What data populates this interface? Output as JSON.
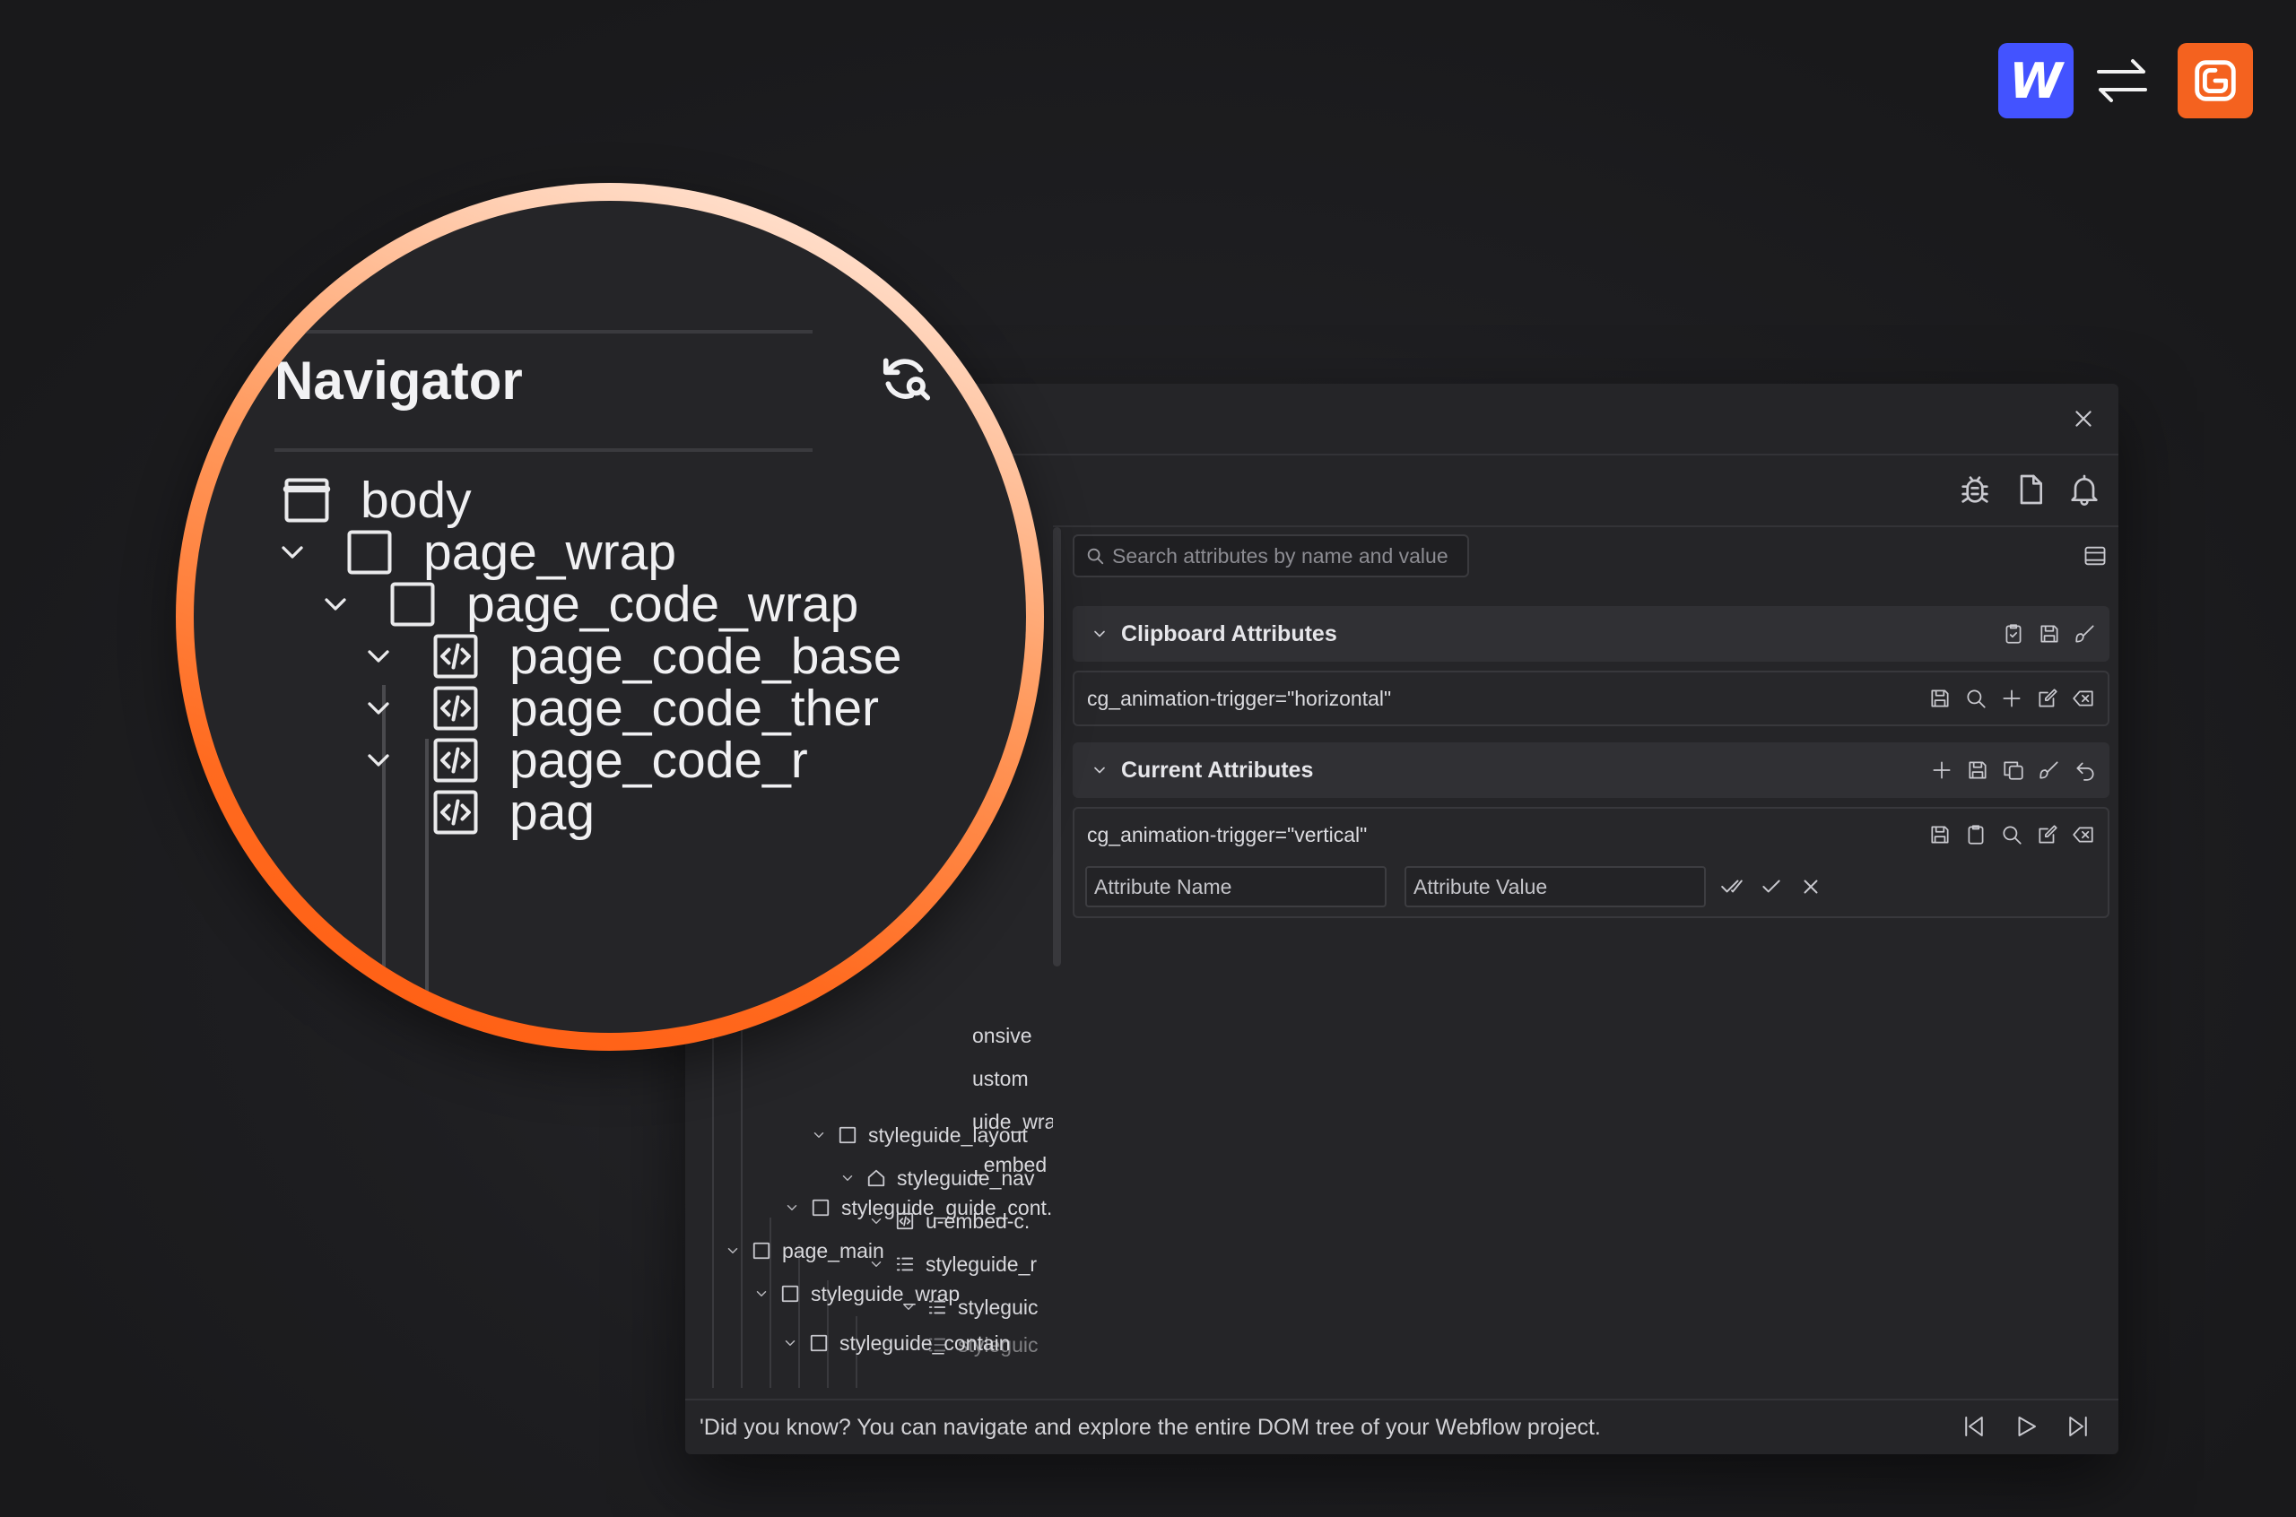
{
  "brand": {
    "webflow_logo_letter": "W",
    "webflow_color": "#4353ff",
    "app_color": "#f4621f",
    "swap_icon": "swap-arrows-icon"
  },
  "magnifier": {
    "title": "Navigator",
    "refresh_icon": "refresh-search-icon",
    "items": [
      {
        "label": "body",
        "icon": "body-icon"
      },
      {
        "label": "page_wrap",
        "icon": "box-icon"
      },
      {
        "label": "page_code_wrap",
        "icon": "box-icon"
      },
      {
        "label": "page_code_base",
        "icon": "code-icon"
      },
      {
        "label": "page_code_ther",
        "icon": "code-icon"
      },
      {
        "label": "page_code_r",
        "icon": "code-icon"
      },
      {
        "label": "pag",
        "icon": "code-icon"
      }
    ]
  },
  "toolbar": {
    "close_icon": "close-icon",
    "debug_icon": "bug-icon",
    "file_icon": "file-icon",
    "bell_icon": "bell-icon"
  },
  "navigator": {
    "items": [
      {
        "label": "onsive"
      },
      {
        "label": "ustom"
      },
      {
        "label": "uide_wrap"
      },
      {
        "label": "_embed"
      },
      {
        "label": "styleguide_guide_cont.."
      },
      {
        "label": "page_main"
      },
      {
        "label": "styleguide_wrap"
      },
      {
        "label": "styleguide_contain"
      },
      {
        "label": "styleguide_layout"
      },
      {
        "label": "styleguide_nav"
      },
      {
        "label": "u-embed-c."
      },
      {
        "label": "styleguide_r"
      },
      {
        "label": "styleguic"
      },
      {
        "label": "styleguic"
      }
    ]
  },
  "attributes": {
    "search_placeholder": "Search attributes by name and value",
    "clipboard_title": "Clipboard Attributes",
    "clipboard_items": [
      "cg_animation-trigger=\"horizontal\""
    ],
    "current_title": "Current Attributes",
    "current_items": [
      "cg_animation-trigger=\"vertical\""
    ],
    "name_placeholder": "Attribute Name",
    "value_placeholder": "Attribute Value"
  },
  "footer": {
    "tip": "'Did you know? You can navigate and explore the entire DOM tree of your Webflow project."
  }
}
